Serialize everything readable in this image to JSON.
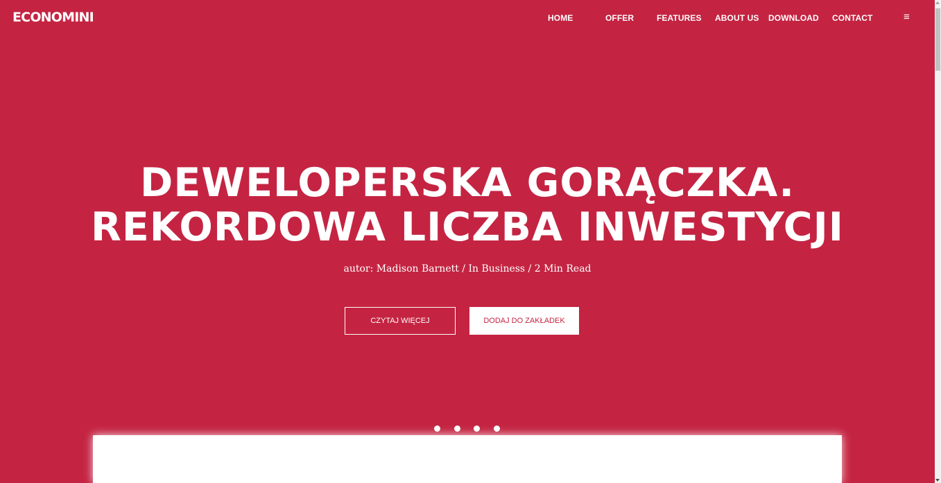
{
  "brand": {
    "logo_text": "ECONOMINI"
  },
  "nav": {
    "items": [
      {
        "label": "HOME"
      },
      {
        "label": "OFFER"
      },
      {
        "label": "FEATURES"
      },
      {
        "label": "ABOUT US"
      },
      {
        "label": "DOWNLOAD"
      },
      {
        "label": "CONTACT"
      }
    ],
    "menu_icon": "≡"
  },
  "hero": {
    "headline_line1": "DEWELOPERSKA GORĄCZKA.",
    "headline_line2": "REKORDOWA LICZBA INWESTYCJI",
    "meta": "autor: Madison Barnett / In Business / 2 Min Read",
    "read_more_label": "CZYTAJ WIĘCEJ",
    "bookmark_label": "DODAJ DO ZAKŁADEK"
  },
  "carousel": {
    "slide_count": 4
  },
  "colors": {
    "accent": "#c42442",
    "text": "#ffffff"
  }
}
